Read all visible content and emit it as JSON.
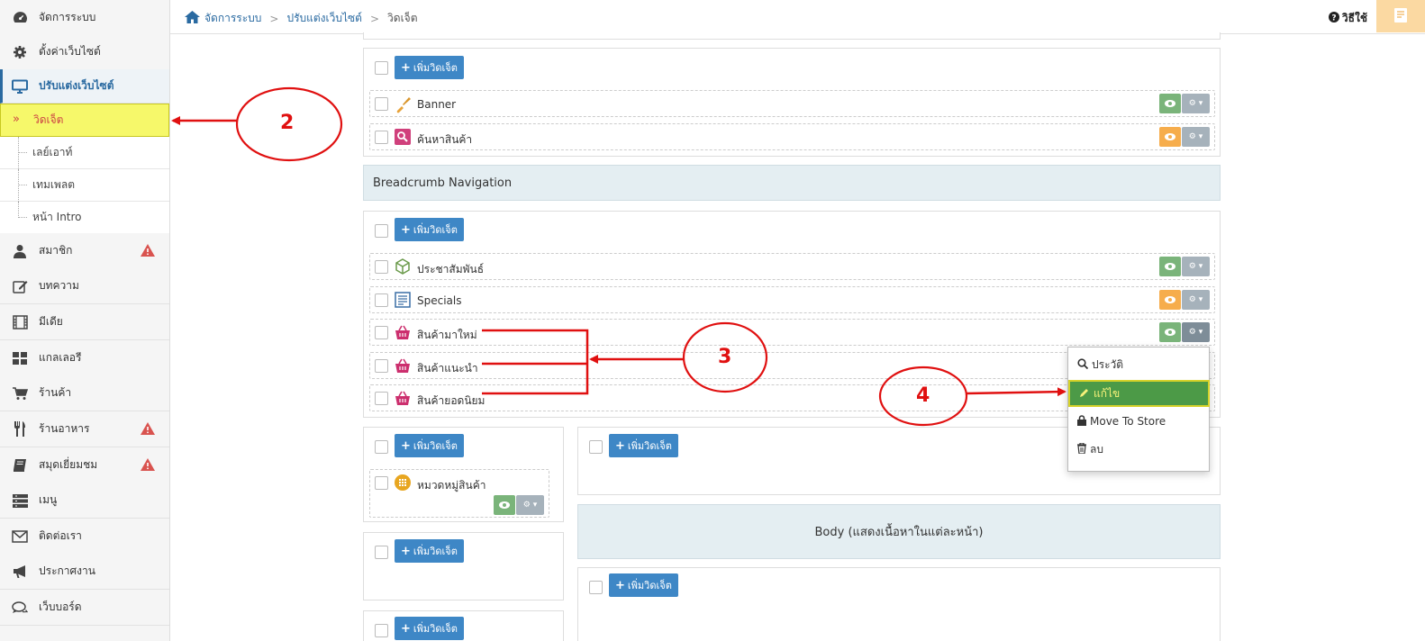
{
  "sidebar": {
    "items": [
      {
        "key": "system",
        "label": "จัดการระบบ",
        "icon": "dashboard-icon"
      },
      {
        "key": "settings",
        "label": "ตั้งค่าเว็บไซต์",
        "icon": "gear-icon"
      },
      {
        "key": "customize",
        "label": "ปรับแต่งเว็บไซต์",
        "icon": "monitor-icon"
      }
    ],
    "subitems": [
      {
        "label": "วิดเจ็ต"
      },
      {
        "label": "เลย์เอาท์"
      },
      {
        "label": "เทมเพลต"
      },
      {
        "label": "หน้า Intro"
      }
    ],
    "items2": [
      {
        "label": "สมาชิก",
        "icon": "user-icon",
        "warning": true
      },
      {
        "label": "บทความ",
        "icon": "edit-icon"
      },
      {
        "label": "มีเดีย",
        "icon": "film-icon"
      },
      {
        "label": "แกลเลอรี",
        "icon": "grid-icon"
      },
      {
        "label": "ร้านค้า",
        "icon": "cart-icon"
      },
      {
        "label": "ร้านอาหาร",
        "icon": "utensils-icon",
        "warning": true
      },
      {
        "label": "สมุดเยี่ยมชม",
        "icon": "book-icon",
        "warning": true
      },
      {
        "label": "เมนู",
        "icon": "menu-bars-icon"
      },
      {
        "label": "ติดต่อเรา",
        "icon": "envelope-icon"
      },
      {
        "label": "ประกาศงาน",
        "icon": "megaphone-icon"
      },
      {
        "label": "เว็บบอร์ด",
        "icon": "comments-icon"
      }
    ]
  },
  "header": {
    "breadcrumb": [
      "จัดการระบบ",
      "ปรับแต่งเว็บไซต์",
      "วิดเจ็ต"
    ],
    "help_label": "วิธีใช้"
  },
  "main": {
    "add_widget_label": "เพิ่มวิดเจ็ต",
    "top_panel_widgets": [
      {
        "name": "Banner",
        "icon": "brush-icon",
        "visibility": "visible"
      },
      {
        "name": "ค้นหาสินค้า",
        "icon": "search-box-icon",
        "visibility": "hidden"
      }
    ],
    "breadcrumb_section_title": "Breadcrumb Navigation",
    "mid_panel_widgets": [
      {
        "name": "ประชาสัมพันธ์",
        "icon": "cube-icon",
        "visibility": "visible"
      },
      {
        "name": "Specials",
        "icon": "list-doc-icon",
        "visibility": "hidden"
      },
      {
        "name": "สินค้ามาใหม่",
        "icon": "basket-icon",
        "visibility": "visible"
      },
      {
        "name": "สินค้าแนะนำ",
        "icon": "basket-icon"
      },
      {
        "name": "สินค้ายอดนิยม",
        "icon": "basket-icon"
      }
    ],
    "left_panel_widget": {
      "name": "หมวดหมู่สินค้า",
      "icon": "category-grid-icon",
      "visibility": "visible"
    },
    "body_section_title": "Body (แสดงเนื้อหาในแต่ละหน้า)"
  },
  "dropdown": {
    "items": [
      {
        "label": "ประวัติ",
        "icon": "search-icon"
      },
      {
        "label": "แก้ไข",
        "icon": "pencil-icon"
      },
      {
        "label": "Move To Store",
        "icon": "lock-icon"
      },
      {
        "label": "ลบ",
        "icon": "trash-icon"
      }
    ]
  },
  "annotations": {
    "labels": [
      "2",
      "3",
      "4"
    ],
    "color": "#e01010"
  },
  "colors": {
    "accent_blue": "#3e87c6",
    "visible_green": "#7ab47a",
    "hidden_orange": "#f6ad4c",
    "highlight_yellow": "#f6f86a",
    "edit_green": "#4c9a47"
  }
}
